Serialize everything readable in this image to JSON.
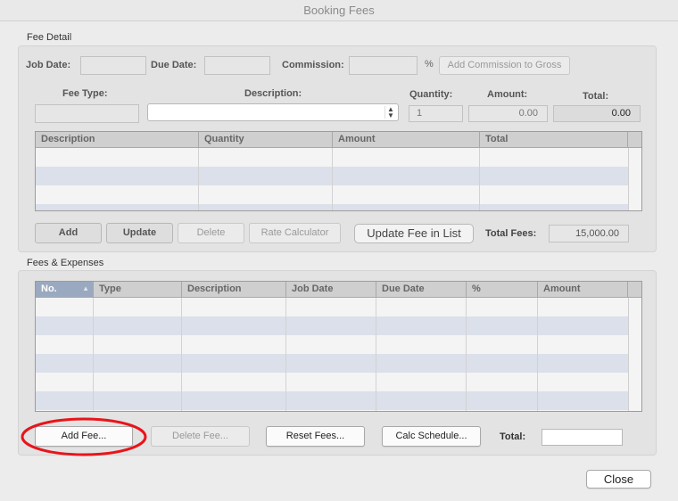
{
  "window": {
    "title": "Booking Fees"
  },
  "fee_detail": {
    "section_label": "Fee Detail",
    "job_date_label": "Job Date:",
    "due_date_label": "Due Date:",
    "commission_label": "Commission:",
    "percent_sign": "%",
    "add_commission_button": "Add Commission to Gross",
    "fee_type_label": "Fee Type:",
    "description_label": "Description:",
    "quantity_label": "Quantity:",
    "amount_label": "Amount:",
    "total_label": "Total:",
    "quantity_value": "1",
    "amount_value": "0.00",
    "total_value": "0.00",
    "table_columns": [
      "Description",
      "Quantity",
      "Amount",
      "Total"
    ],
    "buttons": {
      "add": "Add",
      "update": "Update",
      "delete": "Delete",
      "rate_calculator": "Rate Calculator",
      "update_fee_in_list": "Update Fee in List"
    },
    "total_fees_label": "Total Fees:",
    "total_fees_value": "15,000.00"
  },
  "fees_expenses": {
    "section_label": "Fees & Expenses",
    "table_columns": [
      "No.",
      "Type",
      "Description",
      "Job Date",
      "Due Date",
      "%",
      "Amount"
    ],
    "sort_indicator": "▲",
    "buttons": {
      "add_fee": "Add Fee...",
      "delete_fee": "Delete Fee...",
      "reset_fees": "Reset Fees...",
      "calc_schedule": "Calc Schedule..."
    },
    "total_label": "Total:",
    "total_value": ""
  },
  "close_button": "Close",
  "colors": {
    "highlight_ring": "#e8141a",
    "row_stripe": "#dbe0ea"
  }
}
